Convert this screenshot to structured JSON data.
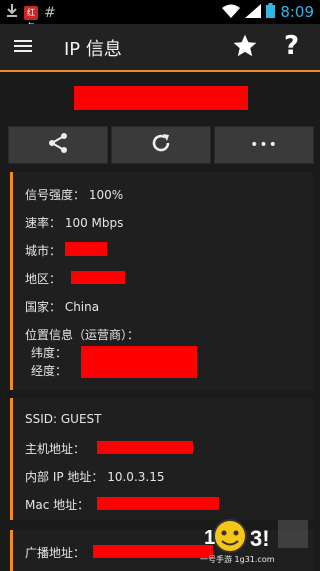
{
  "status_bar": {
    "time": "8:09",
    "app_badge": "红包",
    "hash": "#"
  },
  "app_bar": {
    "title": "IP 信息",
    "favorite_icon": "star-icon",
    "help_label": "?"
  },
  "ip_banner": {
    "value": ""
  },
  "toolbar": [
    {
      "icon": "share-icon"
    },
    {
      "icon": "refresh-icon"
    },
    {
      "label": "•••"
    }
  ],
  "info_section": {
    "signal": "信号强度： 100%",
    "speed": "速率： 100 Mbps",
    "city_label": "城市：",
    "region_label": "地区：",
    "country": "国家： China",
    "location_label": "位置信息（运营商）：",
    "latitude_label": "纬度：",
    "longitude_label": "经度："
  },
  "network_section": {
    "ssid": "SSID: GUEST",
    "host_label": "主机地址：",
    "internal_ip": "内部 IP 地址： 10.0.3.15",
    "mac_label": "Mac 地址："
  },
  "broadcast_section": {
    "broadcast_label": "广播地址："
  },
  "watermark": {
    "text": "一号手游 1g31.com"
  },
  "colors": {
    "accent": "#f08a24",
    "redaction": "#ff0000",
    "time_blue": "#33b5e5"
  }
}
